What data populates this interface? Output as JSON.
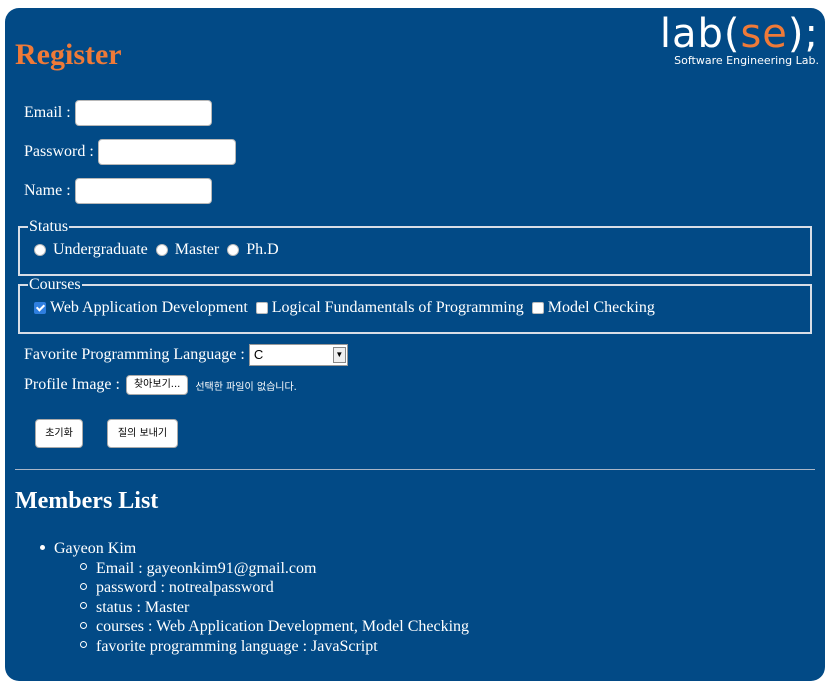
{
  "page": {
    "title": "Register"
  },
  "logo": {
    "main_prefix": "lab",
    "main_open": "(",
    "main_accent": "se",
    "main_close": ");",
    "subtitle": "Software Engineering Lab."
  },
  "form": {
    "email_label": "Email :",
    "email_value": "",
    "password_label": "Password :",
    "password_value": "",
    "name_label": "Name :",
    "name_value": "",
    "status": {
      "legend": "Status",
      "options": [
        "Undergraduate",
        "Master",
        "Ph.D"
      ],
      "selected": null
    },
    "courses": {
      "legend": "Courses",
      "options": [
        {
          "label": "Web Application Development",
          "checked": true
        },
        {
          "label": "Logical Fundamentals of Programming",
          "checked": false
        },
        {
          "label": "Model Checking",
          "checked": false
        }
      ]
    },
    "language_label": "Favorite Programming Language :",
    "language_selected": "C",
    "profile_label": "Profile Image :",
    "file_button": "찾아보기...",
    "file_status": "선택한 파일이 없습니다.",
    "reset_button": "초기화",
    "submit_button": "질의 보내기"
  },
  "members": {
    "title": "Members List",
    "list": [
      {
        "name": "Gayeon Kim",
        "details": [
          "Email : gayeonkim91@gmail.com",
          "password : notrealpassword",
          "status : Master",
          "courses : Web Application Development, Model Checking",
          "favorite programming language : JavaScript"
        ]
      }
    ]
  },
  "colors": {
    "panel": "#024a86",
    "accent": "#ef7a38",
    "text": "#ffffff"
  }
}
